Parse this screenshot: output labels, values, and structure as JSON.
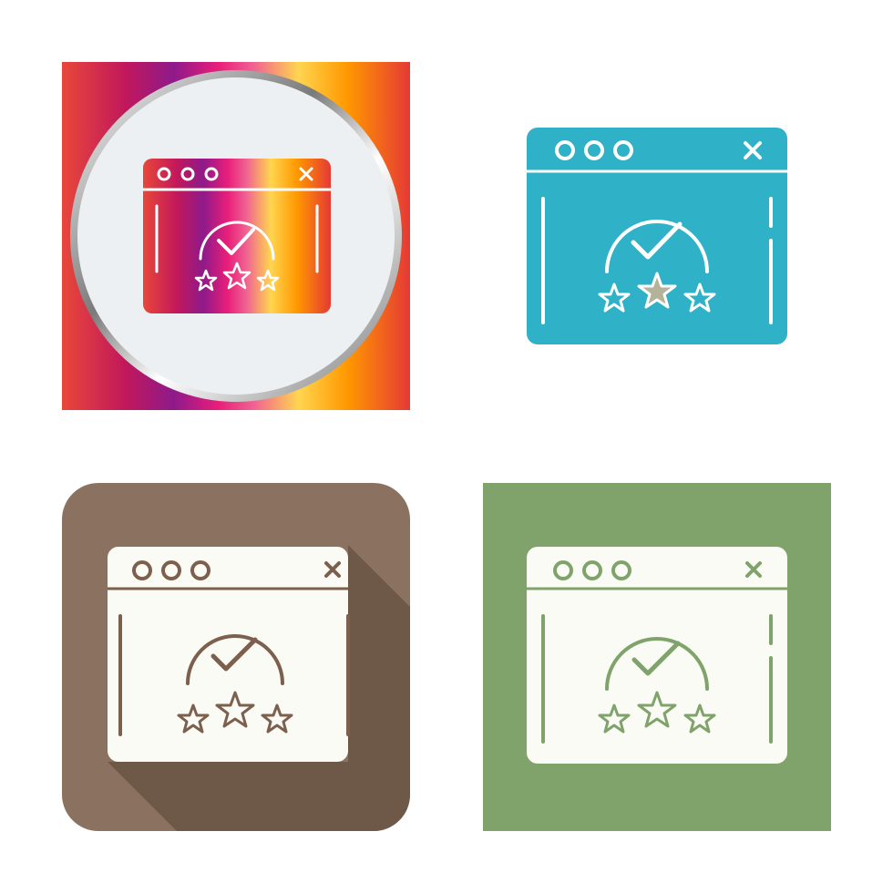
{
  "icons": [
    {
      "name": "rated-website-icon",
      "style": "gradient-in-circle",
      "colors": {
        "gradient_stops": [
          "#e8473a",
          "#c2185b",
          "#8e1a8a",
          "#e91e7a",
          "#f06292",
          "#ffd54f",
          "#ff9800",
          "#e53935"
        ],
        "circle_fill": "#edf0f2",
        "ring": "#9e9e9e",
        "line": "#ffffff"
      }
    },
    {
      "name": "rated-website-icon",
      "style": "flat-glyph",
      "colors": {
        "window": "#2fb1c7",
        "line": "#ffffff",
        "accent_star": "#b4b39a"
      }
    },
    {
      "name": "rated-website-icon",
      "style": "rounded-square-long-shadow",
      "colors": {
        "background": "#8b7260",
        "shadow": "#6e5847",
        "window": "#fbfbf5",
        "line": "#7c5f4d"
      }
    },
    {
      "name": "rated-website-icon",
      "style": "square-outline",
      "colors": {
        "background": "#7fa36a",
        "window": "#fbfbf5",
        "line": "#7fa36a"
      }
    }
  ]
}
